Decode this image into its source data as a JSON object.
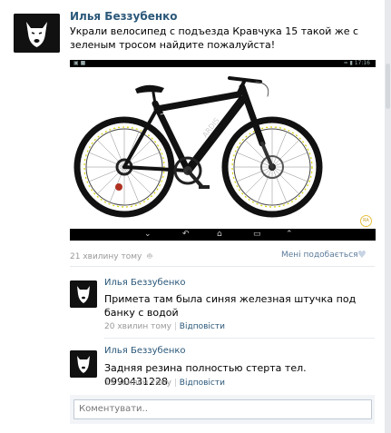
{
  "post": {
    "author": "Илья Беззубенко",
    "text": "Украли велосипед с подъезда Кравчука 15 такой же с зеленым тросом найдите пожалуйста!",
    "time": "21 хвилину тому",
    "like_label": "Мені подобається",
    "photo": {
      "statusbar_left": "▣ ■",
      "statusbar_right": "≈ ▮ 17:16",
      "badge": "RA"
    }
  },
  "comments": [
    {
      "author": "Илья Беззубенко",
      "text": "Примета там была синяя железная штучка под банку с водой",
      "time": "20 хвилин тому",
      "reply": "Відповісти"
    },
    {
      "author": "Илья Беззубенко",
      "text": "Задняя резина полностью стерта тел. 0990431228",
      "time": "19 хвилин тому",
      "reply": "Відповісти"
    }
  ],
  "comment_input": {
    "placeholder": "Коментувати.."
  },
  "colors": {
    "link": "#2b587a",
    "meta": "#999999",
    "wheel_accent": "#d9d300"
  }
}
